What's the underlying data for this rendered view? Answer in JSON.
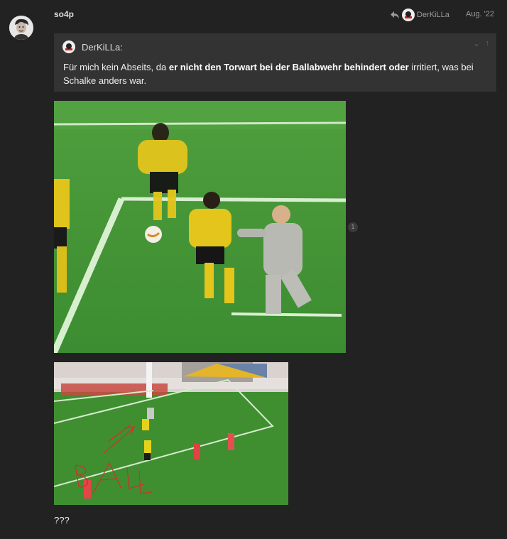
{
  "post": {
    "author": "so4p",
    "reply_to_user": "DerKiLLa",
    "date": "Aug. '22",
    "quote": {
      "author": "DerKiLLa:",
      "text_before": "Für mich kein Abseits, da ",
      "text_bold": "er nicht den Torwart bei der Ballabwehr behindert oder",
      "text_after": " irritiert, was bei Schalke anders war."
    },
    "image_badge": "1",
    "annotation_text": "BALL",
    "body_text": "???"
  },
  "colors": {
    "background": "#222222",
    "quote_background": "#333333",
    "muted_text": "#9a9a9a",
    "annotation_red": "#d0302a"
  }
}
